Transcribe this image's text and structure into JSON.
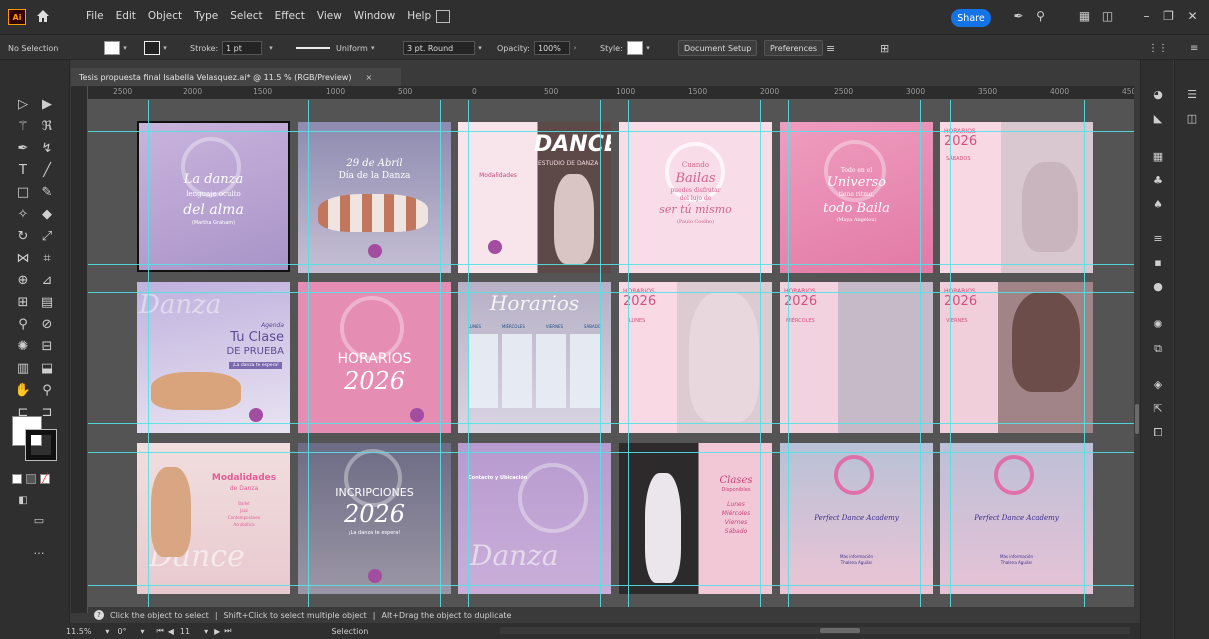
{
  "app": {
    "logo": "Ai",
    "menu": [
      "File",
      "Edit",
      "Object",
      "Type",
      "Select",
      "Effect",
      "View",
      "Window",
      "Help"
    ],
    "share_label": "Share",
    "accent": "#1473e6"
  },
  "control_bar": {
    "selection": "No Selection",
    "stroke_label": "Stroke:",
    "stroke_value": "1 pt",
    "profile": "Uniform",
    "brush": "3 pt. Round",
    "opacity_label": "Opacity:",
    "opacity_value": "100%",
    "style_label": "Style:",
    "document_setup": "Document Setup",
    "preferences": "Preferences"
  },
  "document": {
    "tab_title": "Tesis propuesta final Isabella Velasquez.ai* @ 11.5 % (RGB/Preview)",
    "close": "×",
    "ruler_labels": [
      "2500",
      "2000",
      "1500",
      "1000",
      "500",
      "0",
      "500",
      "1000",
      "1500",
      "2000",
      "2500",
      "3000",
      "3500",
      "4000",
      "4500"
    ]
  },
  "artboards": [
    {
      "id": "la-danza",
      "lines": [
        "La danza",
        "lenguaje oculto",
        "del alma",
        "(Martha Graham)"
      ],
      "bg": "#b9a4d0"
    },
    {
      "id": "dia-danza",
      "lines": [
        "29 de Abril",
        "Día de la Danza"
      ],
      "bg": "#a9a8c4"
    },
    {
      "id": "modalidades-dance",
      "lines": [
        "Modalidades",
        "DANCE",
        "ESTUDIO DE DANZA"
      ],
      "bg": "#f3dbe4"
    },
    {
      "id": "cuando-bailas",
      "lines": [
        "Cuando",
        "Bailas",
        "puedes disfrutar",
        "del lujo de",
        "ser tú mismo",
        "(Paulo Coelho)"
      ],
      "bg": "#f7dbe6"
    },
    {
      "id": "universo",
      "lines": [
        "Todo en el",
        "Universo",
        "tiene ritmo,",
        "todo Baila",
        "(Maya Angelou)"
      ],
      "bg": "#e886ae"
    },
    {
      "id": "horarios-sabados",
      "lines": [
        "HORARIOS",
        "2026",
        "SÁBADOS"
      ],
      "bg": "#f6d2df"
    },
    {
      "id": "clase-prueba",
      "lines": [
        "Agenda",
        "Tu Clase",
        "DE PRUEBA",
        "¡La danza te espera!",
        "Danza"
      ],
      "bg": "#c6b4dc"
    },
    {
      "id": "horarios-2026",
      "lines": [
        "HORARIOS",
        "2026"
      ],
      "bg": "#e790b5"
    },
    {
      "id": "tabla-horarios",
      "lines": [
        "Horarios",
        "LUNES",
        "MIÉRCOLES",
        "VIERNES",
        "SÁBADO"
      ],
      "bg": "#c9c4d6"
    },
    {
      "id": "horarios-lunes",
      "lines": [
        "HORARIOS",
        "2026",
        "LUNES"
      ],
      "bg": "#f5d8e3"
    },
    {
      "id": "horarios-miercoles",
      "lines": [
        "HORARIOS",
        "2026",
        "MIÉRCOLES"
      ],
      "bg": "#f2cddd"
    },
    {
      "id": "horarios-viernes",
      "lines": [
        "HORARIOS",
        "2026",
        "VIERNES"
      ],
      "bg": "#e3b7cb"
    },
    {
      "id": "modalidades",
      "lines": [
        "Modalidades",
        "de Danza",
        "Ballet",
        "Jazz",
        "Contemporáneo",
        "Acrobática",
        "Dance"
      ],
      "bg": "#f0d9dc"
    },
    {
      "id": "inscripciones",
      "lines": [
        "INCRIPCIONES",
        "2026",
        "¡La danza te espera!"
      ],
      "bg": "#6c6a82"
    },
    {
      "id": "contacto",
      "lines": [
        "Contacto y Ubicación",
        "Danza"
      ],
      "bg": "#c1a7d3"
    },
    {
      "id": "clases",
      "lines": [
        "Clases",
        "Disponibles",
        "Lunes",
        "Miércoles",
        "Viernes",
        "Sábado"
      ],
      "bg": "#f1c5d4"
    },
    {
      "id": "academy-1",
      "lines": [
        "Perfect Dance Academy",
        "Más información",
        "Thalena Aguilar"
      ],
      "bg": "#e1c0d9"
    },
    {
      "id": "academy-2",
      "lines": [
        "Perfect Dance Academy",
        "Más información",
        "Thalena Aguilar"
      ],
      "bg": "#d9bdd6"
    }
  ],
  "status": {
    "hint": [
      "Click the object to select",
      "Shift+Click to select multiple object",
      "Alt+Drag the object to duplicate"
    ],
    "zoom": "11.5%",
    "rotation": "0°",
    "artboard_num": "11",
    "tool": "Selection"
  }
}
